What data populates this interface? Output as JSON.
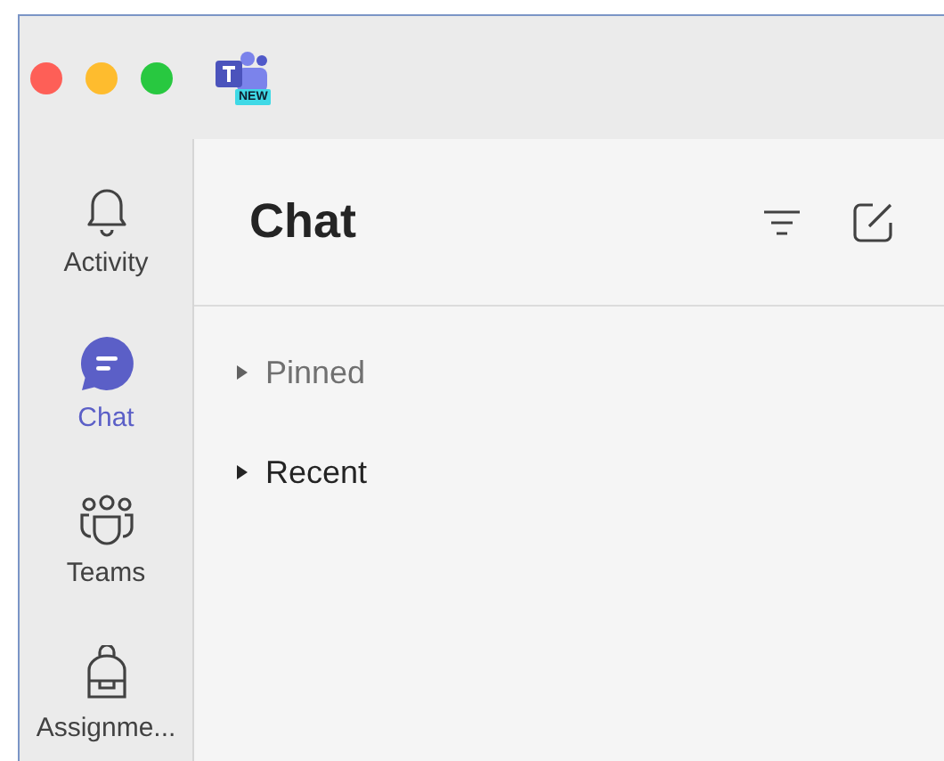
{
  "title_bar": {
    "logo_badge": "NEW"
  },
  "rail": [
    {
      "kind": "bell",
      "label": "Activity",
      "selected": false
    },
    {
      "kind": "chat",
      "label": "Chat",
      "selected": true
    },
    {
      "kind": "teams",
      "label": "Teams",
      "selected": false
    },
    {
      "kind": "backpack",
      "label": "Assignme...",
      "selected": false
    }
  ],
  "header": {
    "title": "Chat"
  },
  "sections": [
    {
      "label": "Pinned",
      "dimmed": true,
      "expanded": false
    },
    {
      "label": "Recent",
      "dimmed": false,
      "expanded": false
    }
  ]
}
